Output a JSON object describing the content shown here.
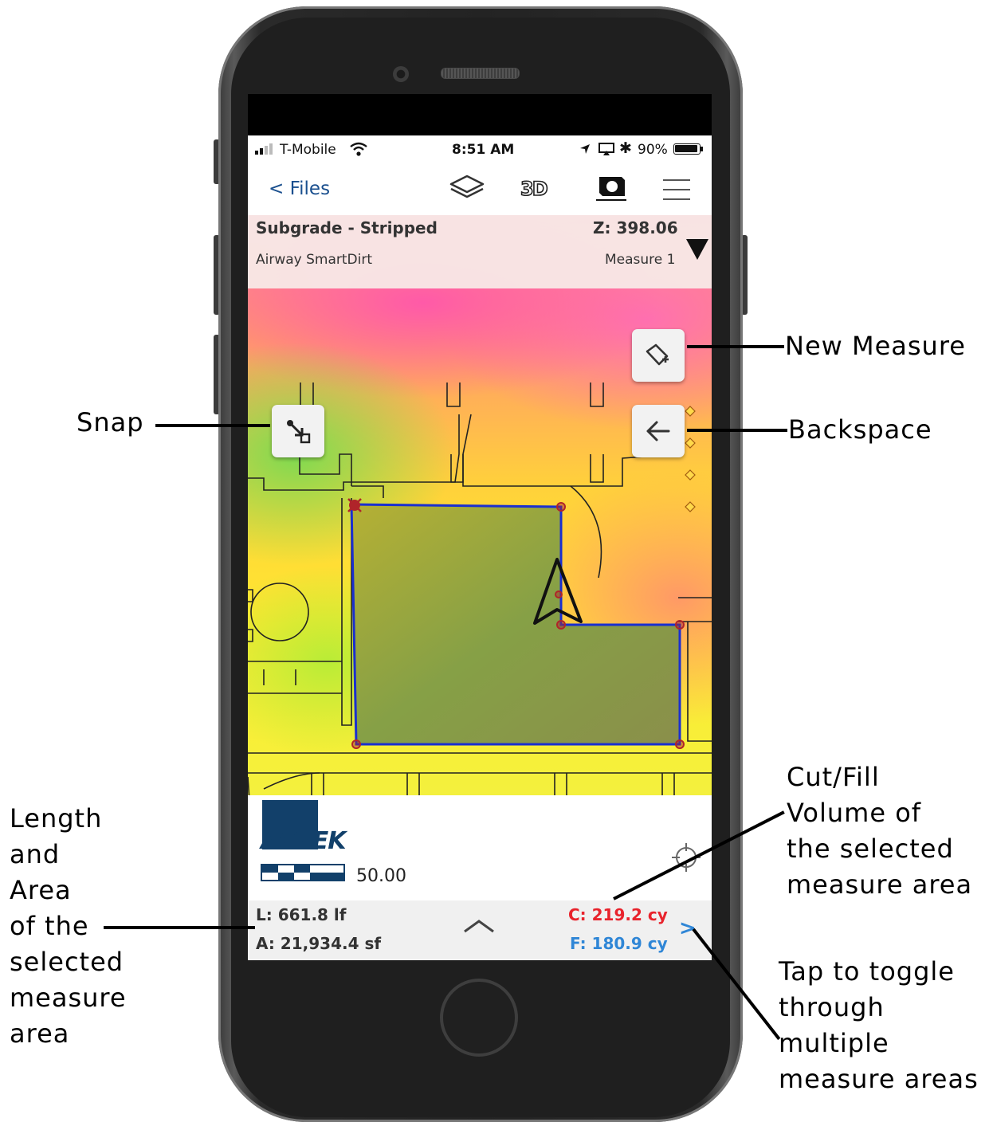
{
  "callouts": {
    "new_measure": "New Measure",
    "backspace": "Backspace",
    "snap": "Snap",
    "cut_fill": "Cut/Fill\nVolume of\nthe selected\nmeasure area",
    "length_area": "Length\nand\nArea\nof the\nselected\nmeasure\narea",
    "toggle": "Tap to toggle\nthrough\nmultiple\nmeasure areas"
  },
  "status_bar": {
    "carrier": "T-Mobile",
    "time": "8:51 AM",
    "battery": "90%"
  },
  "nav": {
    "back_label": "< Files",
    "view_3d_label": "3D",
    "icons": [
      "layers-icon",
      "3d-icon",
      "camera-icon",
      "menu-icon"
    ]
  },
  "info_header": {
    "surface": "Subgrade - Stripped",
    "elevation": "Z: 398.06",
    "project": "Airway SmartDirt",
    "measure": "Measure 1"
  },
  "legend": {
    "logo": "AGTEK",
    "scale_value": "50.00"
  },
  "measurement": {
    "length": "L: 661.8 lf",
    "area": "A: 21,934.4 sf",
    "cut": "C: 219.2 cy",
    "fill": "F: 180.9 cy",
    "next_label": ">"
  },
  "colors": {
    "cut": "#e8232c",
    "fill": "#2f86d6",
    "measure_outline": "#1a2fd0",
    "link": "#1a4f8e"
  }
}
